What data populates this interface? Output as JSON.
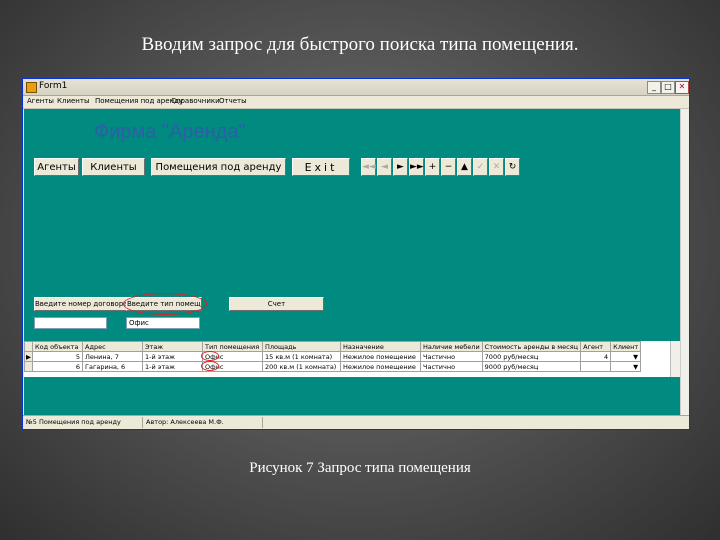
{
  "slide": {
    "title": "Вводим запрос для быстрого поиска типа помещения.",
    "caption": "Рисунок 7 Запрос типа помещения"
  },
  "window": {
    "title": "Form1",
    "controls": {
      "minimize": "_",
      "maximize": "□",
      "close": "✕"
    }
  },
  "menu": {
    "items": [
      "Агенты",
      "Клиенты",
      "Помещения под аренду",
      "Справочники",
      "Отчеты"
    ]
  },
  "form": {
    "firm_title": "Фирма \"Аренда\"",
    "buttons": {
      "agents": "Агенты",
      "clients": "Клиенты",
      "premises": "Помещения под аренду",
      "exit": "Exit"
    },
    "navigator": [
      "◄◄",
      "◄",
      "►",
      "►►",
      "+",
      "−",
      "▲",
      "✓",
      "✕",
      "↻"
    ],
    "search": {
      "contract_button": "Введите номер договора",
      "type_button": "Введите тип помещения",
      "count_button": "Счет",
      "contract_value": "",
      "type_value": "Офис"
    },
    "grid": {
      "columns": [
        "Код объекта",
        "Адрес",
        "Этаж",
        "Тип помещения",
        "Площадь",
        "Назначение",
        "Наличие мебели",
        "Стоимость аренды в месяц",
        "Агент",
        "Клиент"
      ],
      "rows": [
        [
          "5",
          "Ленина, 7",
          "1-й этаж",
          "Офис",
          "15 кв.м (1 комната)",
          "Нежилое помещение",
          "Частично",
          "7000 руб/месяц",
          "4",
          "▼"
        ],
        [
          "6",
          "Гагарина, 6",
          "1-й этаж",
          "Офис",
          "200 кв.м (1 комната)",
          "Нежилое помещение",
          "Частично",
          "9000 руб/месяц",
          "",
          "▼"
        ]
      ]
    }
  },
  "status": {
    "left": "№5 Помещения под аренду",
    "right": "Автор: Алексеева М.Ф."
  },
  "colors": {
    "form_bg": "#008a80",
    "title_text": "#2d5ea8",
    "highlight": "#dd2222"
  }
}
